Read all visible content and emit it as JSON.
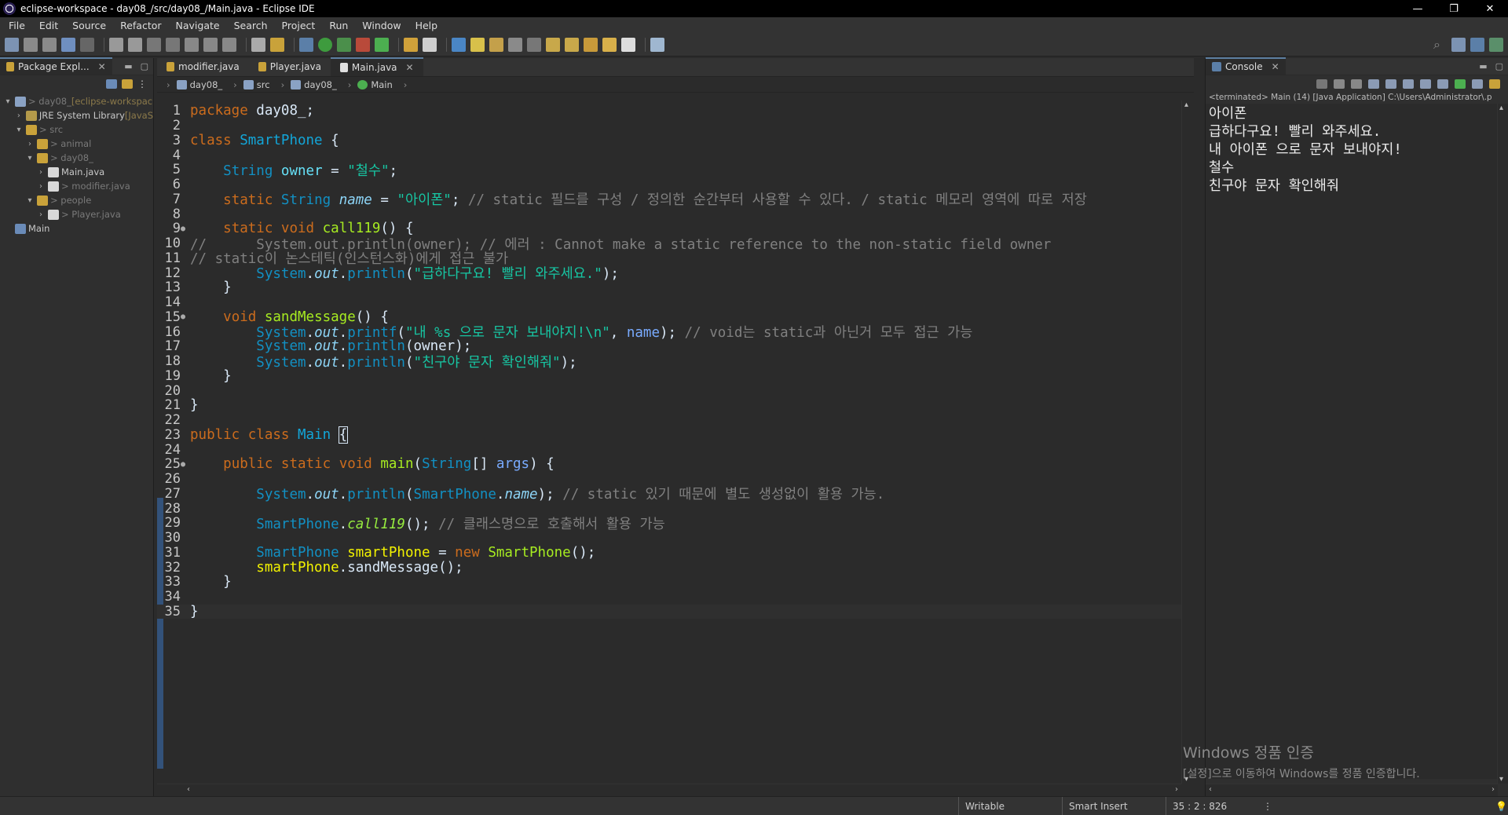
{
  "window": {
    "title": "eclipse-workspace - day08_/src/day08_/Main.java - Eclipse IDE",
    "controls": [
      "—",
      "❐",
      "✕"
    ]
  },
  "menu": [
    "File",
    "Edit",
    "Source",
    "Refactor",
    "Navigate",
    "Search",
    "Project",
    "Run",
    "Window",
    "Help"
  ],
  "package_explorer": {
    "tab_label": "Package Expl...",
    "tree": [
      {
        "indent": 0,
        "arrow": "▾",
        "label": "> day08_",
        "suffix": " [eclipse-workspac",
        "icon": "project-icon"
      },
      {
        "indent": 1,
        "arrow": "›",
        "label": "JRE System Library",
        "suffix": " [JavaS",
        "icon": "library-icon"
      },
      {
        "indent": 1,
        "arrow": "▾",
        "label": "> src",
        "suffix": "",
        "icon": "source-folder-icon"
      },
      {
        "indent": 2,
        "arrow": "›",
        "label": "> animal",
        "suffix": "",
        "icon": "package-icon"
      },
      {
        "indent": 2,
        "arrow": "▾",
        "label": "> day08_",
        "suffix": "",
        "icon": "package-icon"
      },
      {
        "indent": 3,
        "arrow": "›",
        "label": "Main.java",
        "suffix": "",
        "icon": "java-file-icon"
      },
      {
        "indent": 3,
        "arrow": "›",
        "label": "> modifier.java",
        "suffix": "",
        "icon": "java-file-icon"
      },
      {
        "indent": 2,
        "arrow": "▾",
        "label": "> people",
        "suffix": "",
        "icon": "package-icon"
      },
      {
        "indent": 3,
        "arrow": "›",
        "label": "> Player.java",
        "suffix": "",
        "icon": "java-file-icon"
      },
      {
        "indent": 0,
        "arrow": "",
        "label": "Main",
        "suffix": "",
        "icon": "folder-icon"
      }
    ]
  },
  "editor": {
    "tabs": [
      {
        "label": "modifier.java",
        "active": false
      },
      {
        "label": "Player.java",
        "active": false
      },
      {
        "label": "Main.java",
        "active": true
      }
    ],
    "breadcrumb": [
      "day08_",
      "src",
      "day08_",
      "Main"
    ],
    "lines": [
      {
        "n": "1",
        "fold": "",
        "segs": [
          [
            "kw",
            "package"
          ],
          [
            "plain",
            " day08_;"
          ]
        ]
      },
      {
        "n": "2",
        "fold": "",
        "segs": []
      },
      {
        "n": "3",
        "fold": "",
        "segs": [
          [
            "kw",
            "class"
          ],
          [
            "plain",
            " "
          ],
          [
            "cls",
            "SmartPhone"
          ],
          [
            "plain",
            " {"
          ]
        ]
      },
      {
        "n": "4",
        "fold": "",
        "segs": []
      },
      {
        "n": "5",
        "fold": "",
        "segs": [
          [
            "plain",
            "    "
          ],
          [
            "type",
            "String"
          ],
          [
            "plain",
            " "
          ],
          [
            "fld",
            "owner"
          ],
          [
            "plain",
            " = "
          ],
          [
            "str",
            "\"철수\""
          ],
          [
            "plain",
            ";"
          ]
        ]
      },
      {
        "n": "6",
        "fold": "",
        "segs": []
      },
      {
        "n": "7",
        "fold": "",
        "segs": [
          [
            "plain",
            "    "
          ],
          [
            "kw",
            "static"
          ],
          [
            "plain",
            " "
          ],
          [
            "type",
            "String"
          ],
          [
            "plain",
            " "
          ],
          [
            "sfld",
            "name"
          ],
          [
            "plain",
            " = "
          ],
          [
            "str",
            "\"아이폰\""
          ],
          [
            "plain",
            "; "
          ],
          [
            "cmt",
            "// static 필드를 구성 / 정의한 순간부터 사용할 수 있다. / static 메모리 영역에 따로 저장"
          ]
        ]
      },
      {
        "n": "8",
        "fold": "",
        "segs": []
      },
      {
        "n": "9",
        "fold": "●",
        "segs": [
          [
            "plain",
            "    "
          ],
          [
            "kw",
            "static"
          ],
          [
            "plain",
            " "
          ],
          [
            "kw",
            "void"
          ],
          [
            "plain",
            " "
          ],
          [
            "mth",
            "call119"
          ],
          [
            "plain",
            "() {"
          ]
        ]
      },
      {
        "n": "10",
        "fold": "",
        "segs": [
          [
            "cmt",
            "//      System.out.println(owner); // 에러 : Cannot make a static reference to the non-static field owner"
          ]
        ]
      },
      {
        "n": "11",
        "fold": "",
        "segs": [
          [
            "cmt",
            "// static이 논스테틱(인스턴스화)에게 접근 불가"
          ]
        ]
      },
      {
        "n": "12",
        "fold": "",
        "segs": [
          [
            "plain",
            "        "
          ],
          [
            "type",
            "System"
          ],
          [
            "plain",
            "."
          ],
          [
            "sfld",
            "out"
          ],
          [
            "plain",
            "."
          ],
          [
            "type",
            "println"
          ],
          [
            "plain",
            "("
          ],
          [
            "str",
            "\"급하다구요! 빨리 와주세요.\""
          ],
          [
            "plain",
            ");"
          ]
        ]
      },
      {
        "n": "13",
        "fold": "",
        "segs": [
          [
            "plain",
            "    }"
          ]
        ]
      },
      {
        "n": "14",
        "fold": "",
        "segs": []
      },
      {
        "n": "15",
        "fold": "●",
        "segs": [
          [
            "plain",
            "    "
          ],
          [
            "kw",
            "void"
          ],
          [
            "plain",
            " "
          ],
          [
            "mth",
            "sandMessage"
          ],
          [
            "plain",
            "() {"
          ]
        ]
      },
      {
        "n": "16",
        "fold": "",
        "segs": [
          [
            "plain",
            "        "
          ],
          [
            "type",
            "System"
          ],
          [
            "plain",
            "."
          ],
          [
            "sfld",
            "out"
          ],
          [
            "plain",
            "."
          ],
          [
            "type",
            "printf"
          ],
          [
            "plain",
            "("
          ],
          [
            "str",
            "\"내 %s 으로 문자 보내야지!\\n\""
          ],
          [
            "plain",
            ", "
          ],
          [
            "param",
            "name"
          ],
          [
            "plain",
            "); "
          ],
          [
            "cmt",
            "// void는 static과 아닌거 모두 접근 가능"
          ]
        ]
      },
      {
        "n": "17",
        "fold": "",
        "segs": [
          [
            "plain",
            "        "
          ],
          [
            "type",
            "System"
          ],
          [
            "plain",
            "."
          ],
          [
            "sfld",
            "out"
          ],
          [
            "plain",
            "."
          ],
          [
            "type",
            "println"
          ],
          [
            "plain",
            "(owner);"
          ]
        ]
      },
      {
        "n": "18",
        "fold": "",
        "segs": [
          [
            "plain",
            "        "
          ],
          [
            "type",
            "System"
          ],
          [
            "plain",
            "."
          ],
          [
            "sfld",
            "out"
          ],
          [
            "plain",
            "."
          ],
          [
            "type",
            "println"
          ],
          [
            "plain",
            "("
          ],
          [
            "str",
            "\"친구야 문자 확인해줘\""
          ],
          [
            "plain",
            ");"
          ]
        ]
      },
      {
        "n": "19",
        "fold": "",
        "segs": [
          [
            "plain",
            "    }"
          ]
        ]
      },
      {
        "n": "20",
        "fold": "",
        "segs": []
      },
      {
        "n": "21",
        "fold": "",
        "segs": [
          [
            "plain",
            "}"
          ]
        ]
      },
      {
        "n": "22",
        "fold": "",
        "segs": []
      },
      {
        "n": "23",
        "fold": "",
        "segs": [
          [
            "kw",
            "public"
          ],
          [
            "plain",
            " "
          ],
          [
            "kw",
            "class"
          ],
          [
            "plain",
            " "
          ],
          [
            "cls",
            "Main"
          ],
          [
            "plain",
            " "
          ],
          [
            "box",
            "{"
          ]
        ]
      },
      {
        "n": "24",
        "fold": "",
        "segs": []
      },
      {
        "n": "25",
        "fold": "●",
        "segs": [
          [
            "plain",
            "    "
          ],
          [
            "kw",
            "public"
          ],
          [
            "plain",
            " "
          ],
          [
            "kw",
            "static"
          ],
          [
            "plain",
            " "
          ],
          [
            "kw",
            "void"
          ],
          [
            "plain",
            " "
          ],
          [
            "mth",
            "main"
          ],
          [
            "plain",
            "("
          ],
          [
            "type",
            "String"
          ],
          [
            "plain",
            "[] "
          ],
          [
            "param",
            "args"
          ],
          [
            "plain",
            ") {"
          ]
        ]
      },
      {
        "n": "26",
        "fold": "",
        "segs": []
      },
      {
        "n": "27",
        "fold": "",
        "segs": [
          [
            "plain",
            "        "
          ],
          [
            "type",
            "System"
          ],
          [
            "plain",
            "."
          ],
          [
            "sfld",
            "out"
          ],
          [
            "plain",
            "."
          ],
          [
            "type",
            "println"
          ],
          [
            "plain",
            "("
          ],
          [
            "type",
            "SmartPhone"
          ],
          [
            "plain",
            "."
          ],
          [
            "sfld",
            "name"
          ],
          [
            "plain",
            "); "
          ],
          [
            "cmt",
            "// static 있기 때문에 별도 생성없이 활용 가능."
          ]
        ]
      },
      {
        "n": "28",
        "fold": "",
        "segs": []
      },
      {
        "n": "29",
        "fold": "",
        "segs": [
          [
            "plain",
            "        "
          ],
          [
            "type",
            "SmartPhone"
          ],
          [
            "plain",
            "."
          ],
          [
            "smth",
            "call119"
          ],
          [
            "plain",
            "(); "
          ],
          [
            "cmt",
            "// 클래스명으로 호출해서 활용 가능"
          ]
        ]
      },
      {
        "n": "30",
        "fold": "",
        "segs": []
      },
      {
        "n": "31",
        "fold": "",
        "segs": [
          [
            "plain",
            "        "
          ],
          [
            "type",
            "SmartPhone"
          ],
          [
            "plain",
            " "
          ],
          [
            "lvar",
            "smartPhone"
          ],
          [
            "plain",
            " = "
          ],
          [
            "kw",
            "new"
          ],
          [
            "plain",
            " "
          ],
          [
            "mth",
            "SmartPhone"
          ],
          [
            "plain",
            "();"
          ]
        ]
      },
      {
        "n": "32",
        "fold": "",
        "segs": [
          [
            "plain",
            "        "
          ],
          [
            "lvar",
            "smartPhone"
          ],
          [
            "plain",
            ".sandMessage();"
          ]
        ]
      },
      {
        "n": "33",
        "fold": "",
        "segs": [
          [
            "plain",
            "    }"
          ]
        ]
      },
      {
        "n": "34",
        "fold": "",
        "segs": []
      },
      {
        "n": "35",
        "fold": "",
        "segs": [
          [
            "plain",
            "}"
          ]
        ]
      }
    ]
  },
  "console": {
    "tab_label": "Console",
    "status": "<terminated> Main (14) [Java Application] C:\\Users\\Administrator\\.p",
    "output": [
      "아이폰",
      "급하다구요! 빨리 와주세요.",
      "내 아이폰 으로 문자 보내야지!",
      "철수",
      "친구야 문자 확인해줘"
    ]
  },
  "watermark": {
    "line1": "Windows 정품 인증",
    "line2": "[설정]으로 이동하여 Windows를 정품 인증합니다."
  },
  "statusbar": {
    "writable": "Writable",
    "insert_mode": "Smart Insert",
    "position": "35 : 2 : 826"
  }
}
